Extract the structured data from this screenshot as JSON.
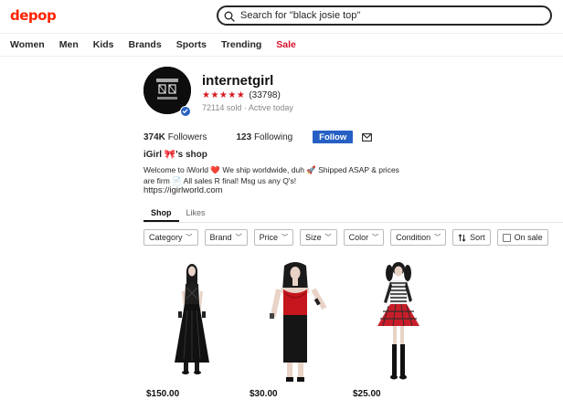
{
  "header": {
    "logo": "depop",
    "search_placeholder": "Search for \"black josie top\""
  },
  "nav": {
    "items": [
      {
        "label": "Women"
      },
      {
        "label": "Men"
      },
      {
        "label": "Kids"
      },
      {
        "label": "Brands"
      },
      {
        "label": "Sports"
      },
      {
        "label": "Trending"
      },
      {
        "label": "Sale"
      }
    ]
  },
  "profile": {
    "username": "internetgirl",
    "stars": "★★★★★",
    "rating_count": "(33798)",
    "sold_line": "72114 sold · Active today",
    "followers_count": "374K",
    "followers_label": "Followers",
    "following_count": "123",
    "following_label": "Following",
    "follow_button": "Follow",
    "shop_name": "iGirl 🎀's shop",
    "bio": "Welcome to iWorld ❤️ We ship worldwide, duh 🚀 Shipped ASAP & prices are firm 📄 All sales R final! Msg us any Q's!",
    "link": "https://igirlworld.com"
  },
  "tabs": [
    {
      "label": "Shop",
      "active": true
    },
    {
      "label": "Likes",
      "active": false
    }
  ],
  "filters": {
    "category": "Category",
    "brand": "Brand",
    "price": "Price",
    "size": "Size",
    "color": "Color",
    "condition": "Condition",
    "sort": "Sort",
    "on_sale": "On sale"
  },
  "products": [
    {
      "price": "$150.00"
    },
    {
      "price": "$30.00"
    },
    {
      "price": "$25.00"
    }
  ],
  "colors": {
    "brand": "#ff2300",
    "sale": "#d8102c",
    "follow": "#2760c4",
    "stars": "#d71920"
  }
}
